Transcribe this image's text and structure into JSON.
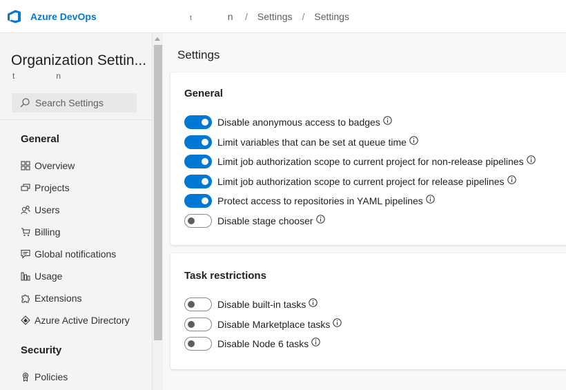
{
  "header": {
    "brand": "Azure DevOps",
    "breadcrumb": {
      "org_start": "t",
      "org_end": "n",
      "items": [
        "Settings",
        "Settings"
      ]
    }
  },
  "sidebar": {
    "title": "Organization Settin...",
    "org_start": "t",
    "org_end": "n",
    "search_placeholder": "Search Settings",
    "sections": [
      {
        "label": "General",
        "items": [
          {
            "label": "Overview",
            "icon": "overview-icon"
          },
          {
            "label": "Projects",
            "icon": "projects-icon"
          },
          {
            "label": "Users",
            "icon": "users-icon"
          },
          {
            "label": "Billing",
            "icon": "cart-icon"
          },
          {
            "label": "Global notifications",
            "icon": "chat-icon"
          },
          {
            "label": "Usage",
            "icon": "usage-icon"
          },
          {
            "label": "Extensions",
            "icon": "puzzle-icon"
          },
          {
            "label": "Azure Active Directory",
            "icon": "aad-icon"
          }
        ]
      },
      {
        "label": "Security",
        "items": [
          {
            "label": "Policies",
            "icon": "policy-icon"
          }
        ]
      }
    ]
  },
  "main": {
    "title": "Settings",
    "general": {
      "title": "General",
      "settings": [
        {
          "label": "Disable anonymous access to badges",
          "on": true
        },
        {
          "label": "Limit variables that can be set at queue time",
          "on": true
        },
        {
          "label": "Limit job authorization scope to current project for non-release pipelines",
          "on": true
        },
        {
          "label": "Limit job authorization scope to current project for release pipelines",
          "on": true
        },
        {
          "label": "Protect access to repositories in YAML pipelines",
          "on": true
        },
        {
          "label": "Disable stage chooser",
          "on": false
        }
      ]
    },
    "task_restrictions": {
      "title": "Task restrictions",
      "settings": [
        {
          "label": "Disable built-in tasks",
          "on": false
        },
        {
          "label": "Disable Marketplace tasks",
          "on": false
        },
        {
          "label": "Disable Node 6 tasks",
          "on": false
        }
      ]
    }
  },
  "colors": {
    "accent": "#0078d4",
    "sidebar_bg": "#f4f4f4",
    "page_bg": "#f8f8f8"
  }
}
